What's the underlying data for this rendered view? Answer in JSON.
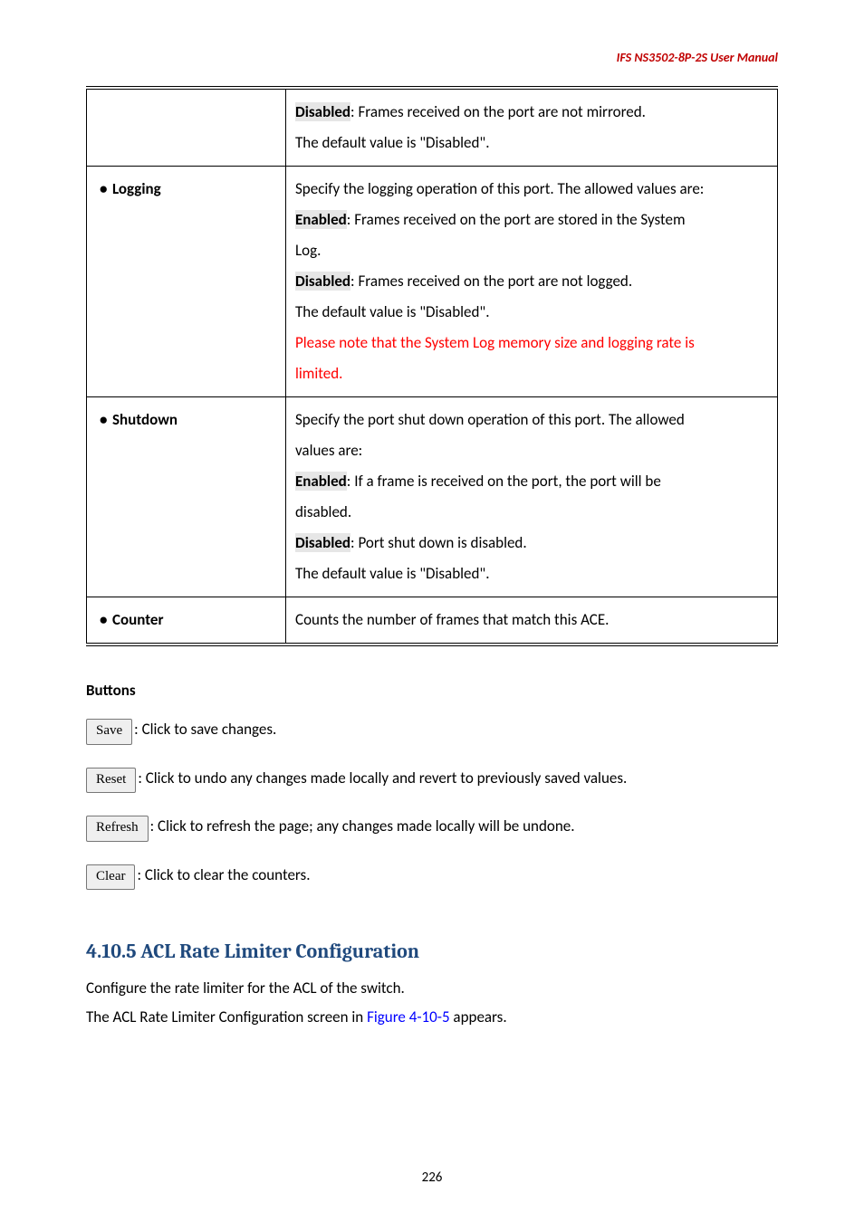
{
  "header": {
    "right": "IFS  NS3502-8P-2S  User  Manual"
  },
  "table": {
    "rows": [
      {
        "label": "",
        "body_html": "<span class='hl' data-name='highlight-disabled' data-interactable='false' data-bind='table.rows.0.parts.0'></span><span data-bind='table.rows.0.parts.1'></span><br><span data-bind='table.rows.0.parts.2'></span>",
        "parts": [
          "Disabled",
          ": Frames received on the port are not mirrored.",
          "The default value is \"Disabled\"."
        ]
      },
      {
        "label": "Logging",
        "body_html": "<span data-bind='table.rows.1.parts.0'></span><br><span class='hl' data-name='highlight-enabled' data-interactable='false' data-bind='table.rows.1.parts.1'></span><span data-bind='table.rows.1.parts.2'></span><br><span data-bind='table.rows.1.parts.3'></span><br><span class='hl' data-name='highlight-disabled' data-interactable='false' data-bind='table.rows.1.parts.4'></span><span data-bind='table.rows.1.parts.5'></span><br><span data-bind='table.rows.1.parts.6'></span><br><span class='red' data-name='warning-text' data-interactable='false' data-bind='table.rows.1.parts.7'></span><br><span class='red' data-name='warning-text' data-interactable='false' data-bind='table.rows.1.parts.8'></span>",
        "parts": [
          "Specify the logging operation of this port. The allowed values are:",
          "Enabled",
          ": Frames received on the port are stored in the System",
          "Log.",
          "Disabled",
          ": Frames received on the port are not logged.",
          "The default value is \"Disabled\".",
          "Please note that the System Log memory size and logging rate is",
          "limited."
        ]
      },
      {
        "label": "Shutdown",
        "body_html": "<span data-bind='table.rows.2.parts.0'></span><br><span data-bind='table.rows.2.parts.1'></span><br><span class='hl' data-name='highlight-enabled' data-interactable='false' data-bind='table.rows.2.parts.2'></span><span data-bind='table.rows.2.parts.3'></span><br><span data-bind='table.rows.2.parts.4'></span><br><span class='hl' data-name='highlight-disabled' data-interactable='false' data-bind='table.rows.2.parts.5'></span><span data-bind='table.rows.2.parts.6'></span><br><span data-bind='table.rows.2.parts.7'></span>",
        "parts": [
          "Specify the port shut down operation of this port. The allowed",
          "values are:",
          "Enabled",
          ": If a frame is received on the port, the port will be",
          "disabled.",
          "Disabled",
          ": Port shut down is disabled.",
          "The default value is \"Disabled\"."
        ]
      },
      {
        "label": "Counter",
        "body_html": "<span data-bind='table.rows.3.parts.0'></span>",
        "parts": [
          "Counts the number of frames that match this ACE."
        ]
      }
    ]
  },
  "buttons_section": {
    "heading": "Buttons",
    "items": [
      {
        "btn": "Save",
        "text": ": Click to save changes."
      },
      {
        "btn": "Reset",
        "text": ": Click to undo any changes made locally and revert to previously saved values."
      },
      {
        "btn": "Refresh",
        "text": ": Click to refresh the page; any changes made locally will be undone."
      },
      {
        "btn": "Clear",
        "text": ": Click to clear the counters."
      }
    ]
  },
  "subsection": {
    "title": "4.10.5 ACL Rate Limiter Configuration",
    "body_pre": "Configure the rate limiter for the ACL of the switch.",
    "body_line2_a": "The ACL Rate Limiter Configuration screen in ",
    "body_line2_link": "Figure 4-10-5",
    "body_line2_b": " appears."
  },
  "page_number": "226"
}
